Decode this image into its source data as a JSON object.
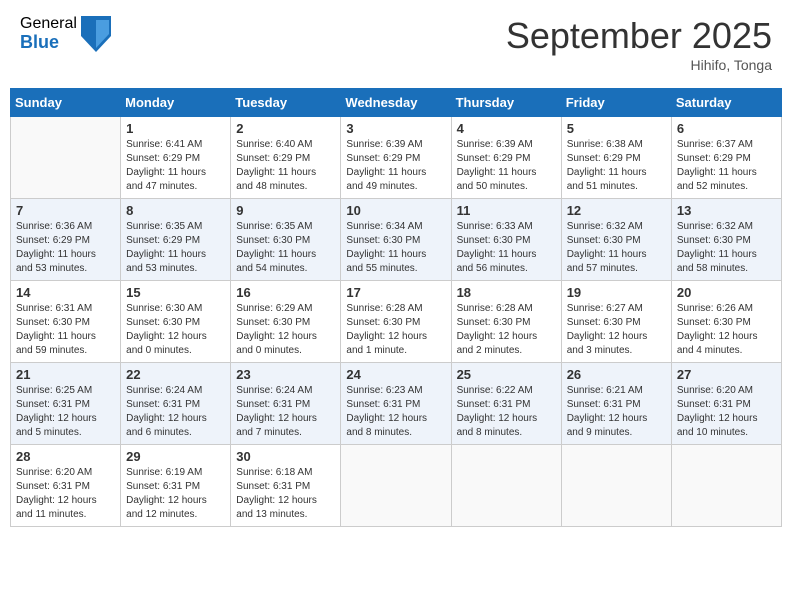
{
  "header": {
    "logo_general": "General",
    "logo_blue": "Blue",
    "month_title": "September 2025",
    "location": "Hihifo, Tonga"
  },
  "days_of_week": [
    "Sunday",
    "Monday",
    "Tuesday",
    "Wednesday",
    "Thursday",
    "Friday",
    "Saturday"
  ],
  "weeks": [
    [
      {
        "day": "",
        "sunrise": "",
        "sunset": "",
        "daylight": ""
      },
      {
        "day": "1",
        "sunrise": "Sunrise: 6:41 AM",
        "sunset": "Sunset: 6:29 PM",
        "daylight": "Daylight: 11 hours and 47 minutes."
      },
      {
        "day": "2",
        "sunrise": "Sunrise: 6:40 AM",
        "sunset": "Sunset: 6:29 PM",
        "daylight": "Daylight: 11 hours and 48 minutes."
      },
      {
        "day": "3",
        "sunrise": "Sunrise: 6:39 AM",
        "sunset": "Sunset: 6:29 PM",
        "daylight": "Daylight: 11 hours and 49 minutes."
      },
      {
        "day": "4",
        "sunrise": "Sunrise: 6:39 AM",
        "sunset": "Sunset: 6:29 PM",
        "daylight": "Daylight: 11 hours and 50 minutes."
      },
      {
        "day": "5",
        "sunrise": "Sunrise: 6:38 AM",
        "sunset": "Sunset: 6:29 PM",
        "daylight": "Daylight: 11 hours and 51 minutes."
      },
      {
        "day": "6",
        "sunrise": "Sunrise: 6:37 AM",
        "sunset": "Sunset: 6:29 PM",
        "daylight": "Daylight: 11 hours and 52 minutes."
      }
    ],
    [
      {
        "day": "7",
        "sunrise": "Sunrise: 6:36 AM",
        "sunset": "Sunset: 6:29 PM",
        "daylight": "Daylight: 11 hours and 53 minutes."
      },
      {
        "day": "8",
        "sunrise": "Sunrise: 6:35 AM",
        "sunset": "Sunset: 6:29 PM",
        "daylight": "Daylight: 11 hours and 53 minutes."
      },
      {
        "day": "9",
        "sunrise": "Sunrise: 6:35 AM",
        "sunset": "Sunset: 6:30 PM",
        "daylight": "Daylight: 11 hours and 54 minutes."
      },
      {
        "day": "10",
        "sunrise": "Sunrise: 6:34 AM",
        "sunset": "Sunset: 6:30 PM",
        "daylight": "Daylight: 11 hours and 55 minutes."
      },
      {
        "day": "11",
        "sunrise": "Sunrise: 6:33 AM",
        "sunset": "Sunset: 6:30 PM",
        "daylight": "Daylight: 11 hours and 56 minutes."
      },
      {
        "day": "12",
        "sunrise": "Sunrise: 6:32 AM",
        "sunset": "Sunset: 6:30 PM",
        "daylight": "Daylight: 11 hours and 57 minutes."
      },
      {
        "day": "13",
        "sunrise": "Sunrise: 6:32 AM",
        "sunset": "Sunset: 6:30 PM",
        "daylight": "Daylight: 11 hours and 58 minutes."
      }
    ],
    [
      {
        "day": "14",
        "sunrise": "Sunrise: 6:31 AM",
        "sunset": "Sunset: 6:30 PM",
        "daylight": "Daylight: 11 hours and 59 minutes."
      },
      {
        "day": "15",
        "sunrise": "Sunrise: 6:30 AM",
        "sunset": "Sunset: 6:30 PM",
        "daylight": "Daylight: 12 hours and 0 minutes."
      },
      {
        "day": "16",
        "sunrise": "Sunrise: 6:29 AM",
        "sunset": "Sunset: 6:30 PM",
        "daylight": "Daylight: 12 hours and 0 minutes."
      },
      {
        "day": "17",
        "sunrise": "Sunrise: 6:28 AM",
        "sunset": "Sunset: 6:30 PM",
        "daylight": "Daylight: 12 hours and 1 minute."
      },
      {
        "day": "18",
        "sunrise": "Sunrise: 6:28 AM",
        "sunset": "Sunset: 6:30 PM",
        "daylight": "Daylight: 12 hours and 2 minutes."
      },
      {
        "day": "19",
        "sunrise": "Sunrise: 6:27 AM",
        "sunset": "Sunset: 6:30 PM",
        "daylight": "Daylight: 12 hours and 3 minutes."
      },
      {
        "day": "20",
        "sunrise": "Sunrise: 6:26 AM",
        "sunset": "Sunset: 6:30 PM",
        "daylight": "Daylight: 12 hours and 4 minutes."
      }
    ],
    [
      {
        "day": "21",
        "sunrise": "Sunrise: 6:25 AM",
        "sunset": "Sunset: 6:31 PM",
        "daylight": "Daylight: 12 hours and 5 minutes."
      },
      {
        "day": "22",
        "sunrise": "Sunrise: 6:24 AM",
        "sunset": "Sunset: 6:31 PM",
        "daylight": "Daylight: 12 hours and 6 minutes."
      },
      {
        "day": "23",
        "sunrise": "Sunrise: 6:24 AM",
        "sunset": "Sunset: 6:31 PM",
        "daylight": "Daylight: 12 hours and 7 minutes."
      },
      {
        "day": "24",
        "sunrise": "Sunrise: 6:23 AM",
        "sunset": "Sunset: 6:31 PM",
        "daylight": "Daylight: 12 hours and 8 minutes."
      },
      {
        "day": "25",
        "sunrise": "Sunrise: 6:22 AM",
        "sunset": "Sunset: 6:31 PM",
        "daylight": "Daylight: 12 hours and 8 minutes."
      },
      {
        "day": "26",
        "sunrise": "Sunrise: 6:21 AM",
        "sunset": "Sunset: 6:31 PM",
        "daylight": "Daylight: 12 hours and 9 minutes."
      },
      {
        "day": "27",
        "sunrise": "Sunrise: 6:20 AM",
        "sunset": "Sunset: 6:31 PM",
        "daylight": "Daylight: 12 hours and 10 minutes."
      }
    ],
    [
      {
        "day": "28",
        "sunrise": "Sunrise: 6:20 AM",
        "sunset": "Sunset: 6:31 PM",
        "daylight": "Daylight: 12 hours and 11 minutes."
      },
      {
        "day": "29",
        "sunrise": "Sunrise: 6:19 AM",
        "sunset": "Sunset: 6:31 PM",
        "daylight": "Daylight: 12 hours and 12 minutes."
      },
      {
        "day": "30",
        "sunrise": "Sunrise: 6:18 AM",
        "sunset": "Sunset: 6:31 PM",
        "daylight": "Daylight: 12 hours and 13 minutes."
      },
      {
        "day": "",
        "sunrise": "",
        "sunset": "",
        "daylight": ""
      },
      {
        "day": "",
        "sunrise": "",
        "sunset": "",
        "daylight": ""
      },
      {
        "day": "",
        "sunrise": "",
        "sunset": "",
        "daylight": ""
      },
      {
        "day": "",
        "sunrise": "",
        "sunset": "",
        "daylight": ""
      }
    ]
  ]
}
